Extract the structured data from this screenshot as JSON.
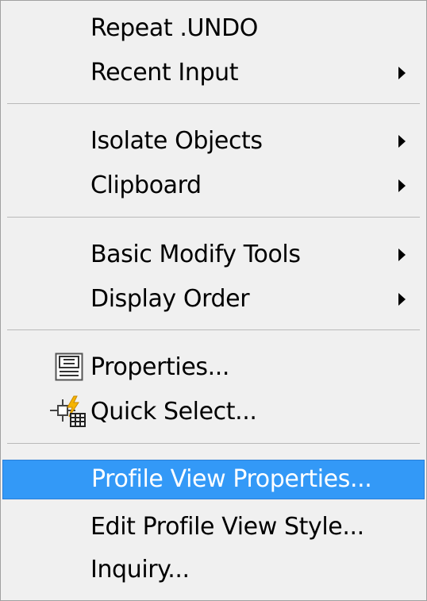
{
  "menu": {
    "items": [
      {
        "label": "Repeat .UNDO",
        "submenu": false
      },
      {
        "label": "Recent Input",
        "submenu": true
      },
      {
        "label": "Isolate Objects",
        "submenu": true
      },
      {
        "label": "Clipboard",
        "submenu": true
      },
      {
        "label": "Basic Modify Tools",
        "submenu": true
      },
      {
        "label": "Display Order",
        "submenu": true
      },
      {
        "label": "Properties...",
        "submenu": false,
        "icon": "properties-icon"
      },
      {
        "label": "Quick Select...",
        "submenu": false,
        "icon": "quick-select-icon"
      },
      {
        "label": "Profile View Properties...",
        "submenu": false,
        "highlighted": true
      },
      {
        "label": "Edit Profile View Style...",
        "submenu": false
      },
      {
        "label": "Inquiry...",
        "submenu": false
      }
    ],
    "colors": {
      "background": "#f0f0f0",
      "highlight": "#3399f7",
      "highlight_text": "#ffffff",
      "separator": "#b9b9b9",
      "quick_select_bolt": "#f5b400"
    }
  }
}
